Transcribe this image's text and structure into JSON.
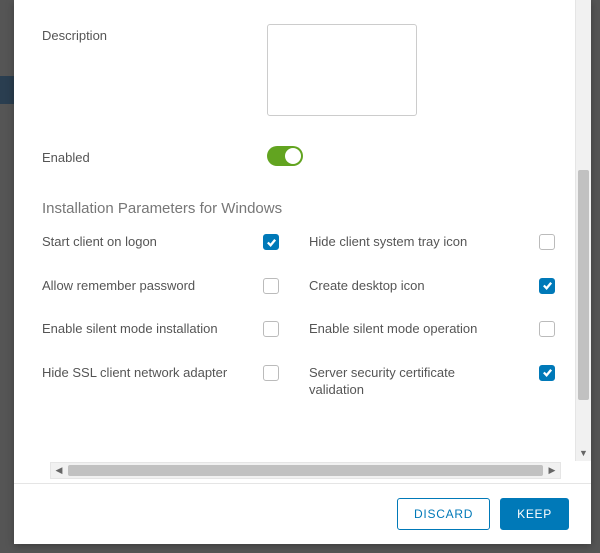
{
  "fields": {
    "description": {
      "label": "Description",
      "value": ""
    },
    "enabled": {
      "label": "Enabled",
      "checked": true
    }
  },
  "section_title": "Installation Parameters for Windows",
  "params": [
    {
      "label": "Start client on logon",
      "checked": true
    },
    {
      "label": "Hide client system tray icon",
      "checked": false
    },
    {
      "label": "Allow remember password",
      "checked": false
    },
    {
      "label": "Create desktop icon",
      "checked": true
    },
    {
      "label": "Enable silent mode installation",
      "checked": false
    },
    {
      "label": "Enable silent mode operation",
      "checked": false
    },
    {
      "label": "Hide SSL client network adapter",
      "checked": false
    },
    {
      "label": "Server security certificate validation",
      "checked": true
    }
  ],
  "footer": {
    "discard": "DISCARD",
    "keep": "KEEP"
  }
}
